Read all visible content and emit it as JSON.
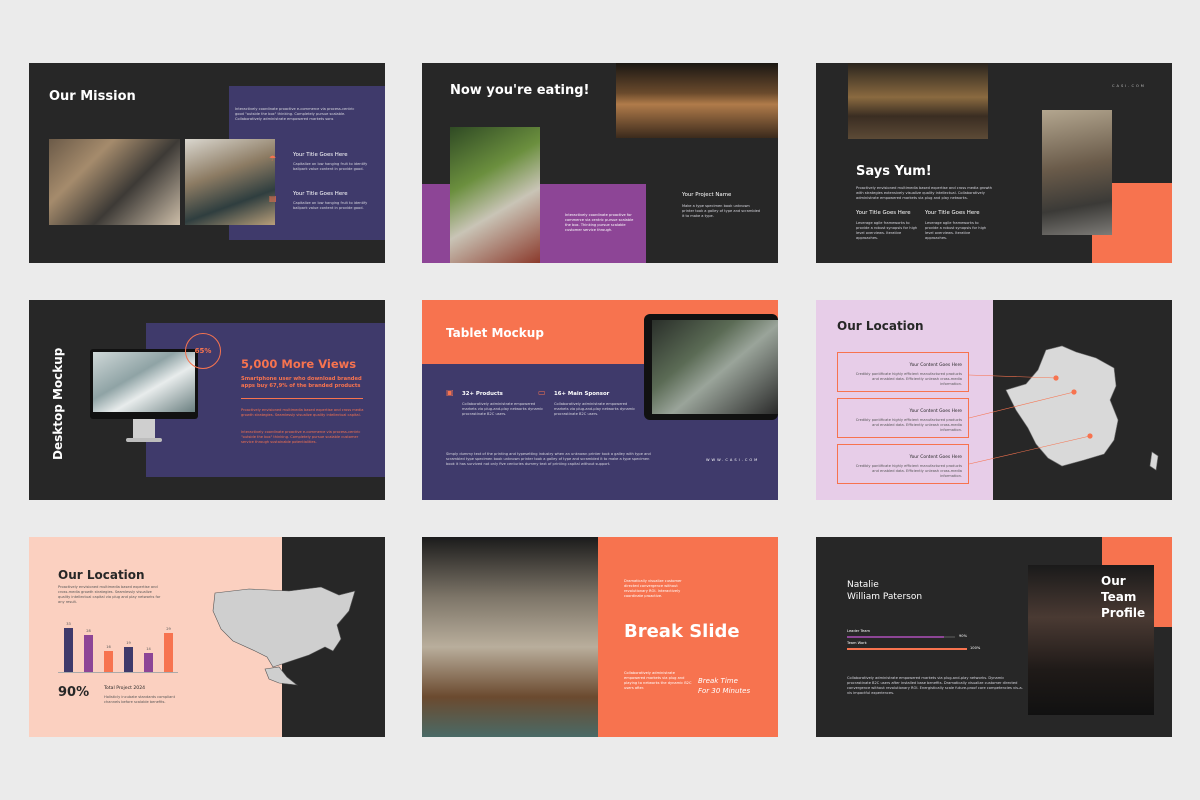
{
  "colors": {
    "dark": "#272727",
    "purple": "#3f3a6b",
    "orange": "#f7734f",
    "magenta": "#8d4596",
    "pink": "#fbd0c0",
    "lilac": "#e7cde8"
  },
  "s1": {
    "title": "Our Mission",
    "intro": "Interactively coordinate proactive e-commerce via process-centric good \"outside the box\" thinking. Completely pursue scalable. Collaboratively administrate empowered markets sons",
    "item1_title": "Your Title Goes Here",
    "item1_text": "Capitalize on low hanging fruit to identify ballpark value content in provide good.",
    "item2_title": "Your Title Goes Here",
    "item2_text": "Capitalize on low hanging fruit to identify ballpark value content in provide good.",
    "icon1": "umbrella-icon",
    "icon2": "store-icon"
  },
  "s2": {
    "title": "Now you're eating!",
    "project": "Your Project Name",
    "project_text": "Make a type specimen book unknown printer took a galley of type and scrambled it to make a type.",
    "box_text": "Interactively coordinate proactive for commerce via centric pursue scalable the box. Thinking pursue scalable customer service through."
  },
  "s3": {
    "site": "CASI.COM",
    "title": "Says Yum!",
    "intro": "Proactively envisioned multimedia based expertise and cross media growth with strategies extensively visualize quality intellectual. Collaboratively administrate empowered markets via plug and play networks.",
    "col1_title": "Your Title Goes Here",
    "col1_text": "Leverage agile frameworks to provide a robust synopsis for high level overviews. Iterative approaches.",
    "col2_title": "Your Title Goes Here",
    "col2_text": "Leverage agile frameworks to provide a robust synopsis for high level overviews. Iterative approaches."
  },
  "s4": {
    "title": "Desktop Mockup",
    "badge": "65%",
    "views": "5,000 More Views",
    "subtitle": "Smartphone user who download branded apps buy 67,9% of the branded products",
    "text1": "Proactively envisioned multimedia based expertise and cross media growth strategies. Seamlessly visualize quality intellectual capital.",
    "text2": "Interactively coordinate proactive e-commerce via process-centric \"outside the box\" thinking. Completely pursue scalable customer service through sustainable potentialities."
  },
  "s5": {
    "title": "Tablet Mockup",
    "stat1": "32+ Products",
    "stat1_text": "Collaboratively administrate empowered markets via plug-and-play networks dynamic procrastinate B2C users.",
    "stat2": "16+ Main Sponsor",
    "stat2_text": "Collaboratively administrate empowered markets via plug-and-play networks dynamic procrastinate B2C users.",
    "body": "Simply dummy text of the printing and typesetting industry when an unknown printer took a galley with type and scrambled type specimen book unknown printer took a galley of type and scrambled it to make a type specimen book it has survived not only five centuries dummy text of printing capital without support.",
    "site": "WWW.CASI.COM",
    "icon1": "briefcase-icon",
    "icon2": "monitor-icon"
  },
  "s6": {
    "title": "Our Location",
    "item1_title": "Your Content Goes Here",
    "item1_text": "Credibly pontificate highly efficient manufactured products and enabled data. Efficiently unleash cross-media information.",
    "item2_title": "Your Content Goes Here",
    "item2_text": "Credibly pontificate highly efficient manufactured products and enabled data. Efficiently unleash cross-media information.",
    "item3_title": "Your Content Goes Here",
    "item3_text": "Credibly pontificate highly efficient manufactured products and enabled data. Efficiently unleash cross-media information."
  },
  "s7": {
    "title": "Our Location",
    "intro": "Proactively envisioned multimedia based expertise and cross-media growth strategies. Seamlessly visualize quality intellectual capital via plug and play networks for any result.",
    "big": "90%",
    "total": "Total Project 2024",
    "total_text": "Holisticly incubate standards compliant channels before scalable benefits.",
    "bars": [
      {
        "value": 33,
        "label": "33",
        "color": "#3f3a6b"
      },
      {
        "value": 28,
        "label": "28",
        "color": "#8d4596"
      },
      {
        "value": 16,
        "label": "16",
        "color": "#f7734f"
      },
      {
        "value": 19,
        "label": "19",
        "color": "#3f3a6b"
      },
      {
        "value": 14,
        "label": "14",
        "color": "#8d4596"
      },
      {
        "value": 29,
        "label": "29",
        "color": "#f7734f"
      }
    ]
  },
  "s8": {
    "top_text": "Dramatically visualize customer directed convergence without revolutionary ROI. Interactively coordinate proactive.",
    "title": "Break Slide",
    "bottom_text": "Collaboratively administrate empowered markets via plug and playing to networks the dynamic B2C users after.",
    "time1": "Break Time",
    "time2": "For 30 Minutes"
  },
  "s9": {
    "first": "Natalie",
    "last": "William Paterson",
    "title1": "Our",
    "title2": "Team",
    "title3": "Profile",
    "skill1": "Leader Team",
    "skill1_val": "90%",
    "skill1_pct": 90,
    "skill2": "Team Work",
    "skill2_val": "100%",
    "skill2_pct": 100,
    "text": "Collaboratively administrate empowered markets via plug-and-play networks. Dynamic procrastinate B2C users after installed base benefits. Dramatically visualize customer directed convergence without revolutionary ROI. Energistically scale future-proof core competencies vis-a-vis impactful experiences."
  }
}
